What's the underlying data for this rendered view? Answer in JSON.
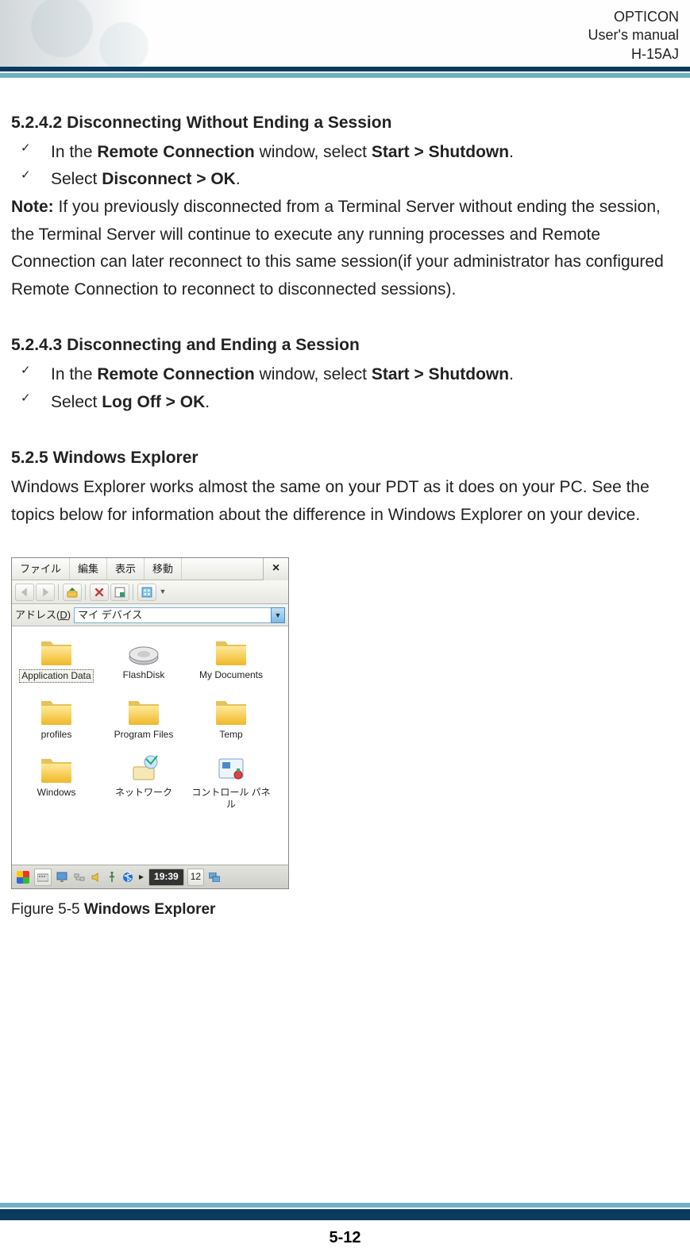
{
  "header": {
    "line1": "OPTICON",
    "line2": "User's manual",
    "line3": "H-15AJ"
  },
  "sec1": {
    "num": "5.2.4.2",
    "title": "Disconnecting Without Ending a Session",
    "bullet1a": "In the ",
    "bullet1b": "Remote Connection",
    "bullet1c": " window, select ",
    "bullet1d": "Start > Shutdown",
    "bullet1e": ".",
    "bullet2a": "Select ",
    "bullet2b": "Disconnect > OK",
    "bullet2c": "."
  },
  "note": {
    "label": "Note:",
    "text": " If you previously disconnected from a Terminal Server without ending the session, the Terminal Server will continue to execute any running processes and Remote Connection can later reconnect to this same session(if your administrator has configured Remote Connection to reconnect to disconnected sessions)."
  },
  "sec2": {
    "num": "5.2.4.3",
    "title": "Disconnecting and Ending a Session",
    "bullet1a": "In the ",
    "bullet1b": "Remote Connection",
    "bullet1c": " window, select ",
    "bullet1d": "Start > Shutdown",
    "bullet1e": ".",
    "bullet2a": "Select ",
    "bullet2b": "Log Off > OK",
    "bullet2c": "."
  },
  "sec3": {
    "num": "5.2.5",
    "title": "Windows Explorer",
    "para": "Windows Explorer works almost the same on your PDT as it does on your PC. See the topics below for information about the difference in Windows Explorer on your device."
  },
  "shot": {
    "menus": {
      "m1": "ファイル",
      "m2": "編集",
      "m3": "表示",
      "m4": "移動"
    },
    "close": "×",
    "toolbar_tips": {
      "back": "back-icon",
      "forward": "forward-icon",
      "up": "up-icon",
      "delete": "delete-icon",
      "props": "properties-icon",
      "view": "view-icon"
    },
    "addr_label_pre": "アドレス(",
    "addr_label_u": "D",
    "addr_label_post": ")",
    "addr_value": "マイ デバイス",
    "items": [
      {
        "name": "Application Data",
        "type": "folder",
        "selected": true
      },
      {
        "name": "FlashDisk",
        "type": "disk"
      },
      {
        "name": "My Documents",
        "type": "folder"
      },
      {
        "name": "profiles",
        "type": "folder"
      },
      {
        "name": "Program Files",
        "type": "folder"
      },
      {
        "name": "Temp",
        "type": "folder"
      },
      {
        "name": "Windows",
        "type": "folder"
      },
      {
        "name": "ネットワーク",
        "type": "network"
      },
      {
        "name": "コントロール パネル",
        "type": "cpanel"
      }
    ],
    "taskbar": {
      "time": "19:39",
      "date": "12"
    }
  },
  "caption": {
    "pre": "Figure 5-5 ",
    "bold": "Windows Explorer"
  },
  "page": "5-12"
}
